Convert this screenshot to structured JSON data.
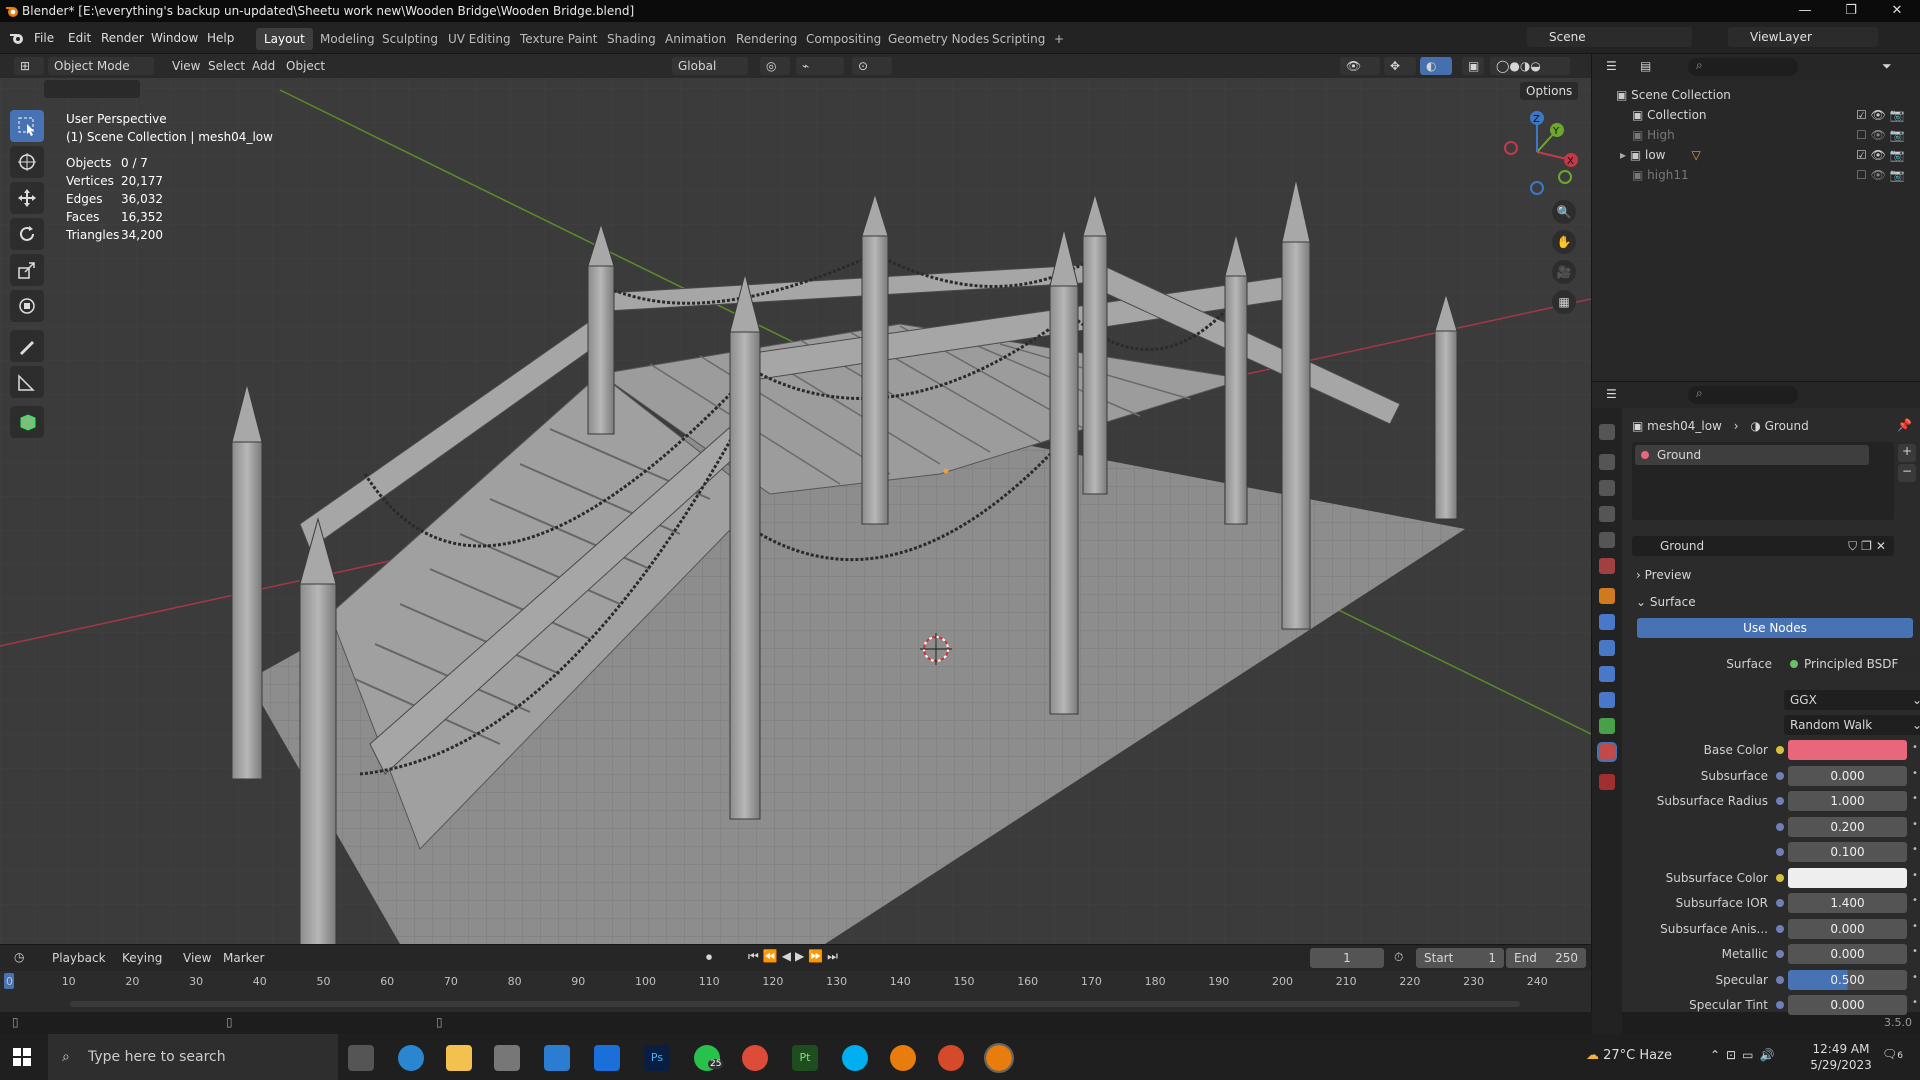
{
  "titlebar": {
    "title": "Blender* [E:\\everything's backup un-updated\\Sheetu work new\\Wooden Bridge\\Wooden Bridge.blend]",
    "minimize": "—",
    "maximize": "❐",
    "close": "✕"
  },
  "menu": {
    "items": [
      "File",
      "Edit",
      "Render",
      "Window",
      "Help"
    ]
  },
  "workspaces": [
    "Layout",
    "Modeling",
    "Sculpting",
    "UV Editing",
    "Texture Paint",
    "Shading",
    "Animation",
    "Rendering",
    "Compositing",
    "Geometry Nodes",
    "Scripting",
    "+"
  ],
  "scene": {
    "name": "Scene",
    "view_layer": "ViewLayer"
  },
  "viewport_header": {
    "mode": "Object Mode",
    "menus": [
      "View",
      "Select",
      "Add",
      "Object"
    ],
    "transform": "Global",
    "options": "Options"
  },
  "overlay": {
    "perspective": "User Perspective",
    "collection_line": "(1) Scene Collection | mesh04_low"
  },
  "stats": [
    {
      "label": "Objects",
      "value": "0 / 7"
    },
    {
      "label": "Vertices",
      "value": "20,177"
    },
    {
      "label": "Edges",
      "value": "36,032"
    },
    {
      "label": "Faces",
      "value": "16,352"
    },
    {
      "label": "Triangles",
      "value": "34,200"
    }
  ],
  "gizmo": {
    "x": "X",
    "y": "Y",
    "z": "Z"
  },
  "timeline": {
    "menus": [
      "Playback",
      "Keying",
      "View",
      "Marker"
    ],
    "current_frame": "1",
    "start_label": "Start",
    "start": "1",
    "end_label": "End",
    "end": "250",
    "ticks": [
      "0",
      "10",
      "20",
      "30",
      "40",
      "50",
      "60",
      "70",
      "80",
      "90",
      "100",
      "110",
      "120",
      "130",
      "140",
      "150",
      "160",
      "170",
      "180",
      "190",
      "200",
      "210",
      "220",
      "230",
      "240"
    ]
  },
  "status": {
    "version": "3.5.0"
  },
  "outliner": {
    "rows": [
      {
        "label": "Scene Collection",
        "dim": false
      },
      {
        "label": "Collection",
        "dim": false
      },
      {
        "label": "High",
        "dim": true
      },
      {
        "label": "low",
        "dim": false
      },
      {
        "label": "high11",
        "dim": true
      }
    ]
  },
  "properties": {
    "breadcrumb_object": "mesh04_low",
    "breadcrumb_material": "Ground",
    "slot": "Ground",
    "material_name": "Ground",
    "preview": "Preview",
    "surface_panel": "Surface",
    "use_nodes": "Use Nodes",
    "surface_label": "Surface",
    "surface_value": "Principled BSDF",
    "distribution": "GGX",
    "subsurface_method": "Random Walk",
    "fields": [
      {
        "label": "Base Color",
        "value": "",
        "kind": "color",
        "color": "#e8677a"
      },
      {
        "label": "Subsurface",
        "value": "0.000",
        "kind": "num"
      },
      {
        "label": "Subsurface Radius",
        "value": "1.000",
        "kind": "num"
      },
      {
        "label": "",
        "value": "0.200",
        "kind": "num"
      },
      {
        "label": "",
        "value": "0.100",
        "kind": "num"
      },
      {
        "label": "Subsurface Color",
        "value": "",
        "kind": "color",
        "color": "#eeeeee"
      },
      {
        "label": "Subsurface IOR",
        "value": "1.400",
        "kind": "num"
      },
      {
        "label": "Subsurface Anis...",
        "value": "0.000",
        "kind": "num"
      },
      {
        "label": "Metallic",
        "value": "0.000",
        "kind": "num"
      },
      {
        "label": "Specular",
        "value": "0.500",
        "kind": "slider",
        "fill": 0.5
      },
      {
        "label": "Specular Tint",
        "value": "0.000",
        "kind": "num"
      }
    ]
  },
  "taskbar": {
    "search_placeholder": "Type here to search",
    "weather": "27°C  Haze",
    "time": "12:49 AM",
    "date": "5/29/2023",
    "whatsapp_badge": "25",
    "notify_badge": "6"
  },
  "colors": {
    "accent": "#4772b3",
    "base_color": "#e8677a",
    "x_axis": "#c3394a",
    "y_axis": "#6da82d",
    "z_axis": "#3d78c8"
  }
}
